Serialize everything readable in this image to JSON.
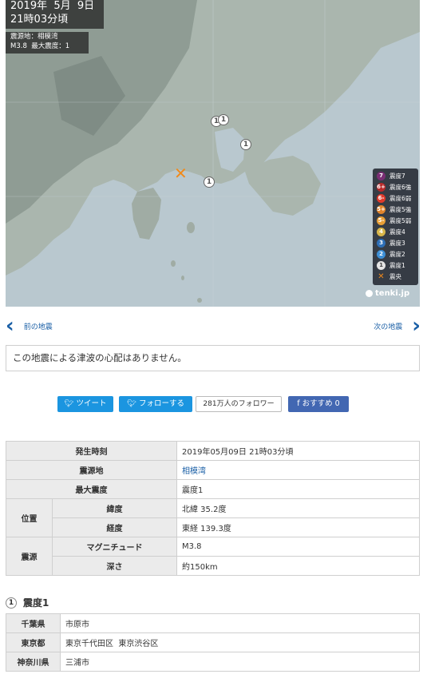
{
  "map": {
    "date_line": "2019年  5月  9日",
    "time_line": "21時03分頃",
    "info_line1": "震源地：相模湾",
    "info_line2": "M3.8  最大震度：1",
    "markers": [
      "1",
      "1",
      "1",
      "1"
    ],
    "epicenter_symbol": "✕",
    "brand": "tenki.jp",
    "colors": {
      "sea": "#b9c8cf",
      "land": "#a9b4ad",
      "epicenter": "#f08a1c"
    }
  },
  "legend": [
    {
      "badge": "7",
      "label": "震度7",
      "color": "#7a2e74"
    },
    {
      "badge": "6+",
      "label": "震度6強",
      "color": "#b72a2a"
    },
    {
      "badge": "6-",
      "label": "震度6弱",
      "color": "#e03a2b"
    },
    {
      "badge": "5+",
      "label": "震度5強",
      "color": "#e0842b"
    },
    {
      "badge": "5-",
      "label": "震度5弱",
      "color": "#e89f36"
    },
    {
      "badge": "4",
      "label": "震度4",
      "color": "#d8b64a"
    },
    {
      "badge": "3",
      "label": "震度3",
      "color": "#2e6fb7"
    },
    {
      "badge": "2",
      "label": "震度2",
      "color": "#3d8fd6"
    },
    {
      "badge": "1",
      "label": "震度1",
      "color": "#e5e5e5"
    },
    {
      "badge": "✕",
      "label": "震央",
      "color": "#f08a1c"
    }
  ],
  "nav": {
    "prev_label": "前の地震",
    "next_label": "次の地震",
    "prev_icon": "‹",
    "next_icon": "›"
  },
  "notice": "この地震による津波の心配はありません。",
  "social": {
    "tweet": "ツイート",
    "follow": "フォローする",
    "followers": "281万人のフォロワー",
    "recommend": "おすすめ 0"
  },
  "details": {
    "time_label": "発生時刻",
    "time_value": "2019年05月09日 21時03分頃",
    "epicenter_label": "震源地",
    "epicenter_value": "相模湾",
    "max_label": "最大震度",
    "max_value": "震度1",
    "position_label": "位置",
    "lat_label": "緯度",
    "lat_value": "北緯 35.2度",
    "lon_label": "経度",
    "lon_value": "東経 139.3度",
    "source_label": "震源",
    "mag_label": "マグニチュード",
    "mag_value": "M3.8",
    "depth_label": "深さ",
    "depth_value": "約150km"
  },
  "intensity": {
    "badge": "1",
    "title": "震度1",
    "rows": [
      {
        "pref": "千葉県",
        "cities": "市原市"
      },
      {
        "pref": "東京都",
        "cities": "東京千代田区  東京渋谷区"
      },
      {
        "pref": "神奈川県",
        "cities": "三浦市"
      }
    ]
  }
}
